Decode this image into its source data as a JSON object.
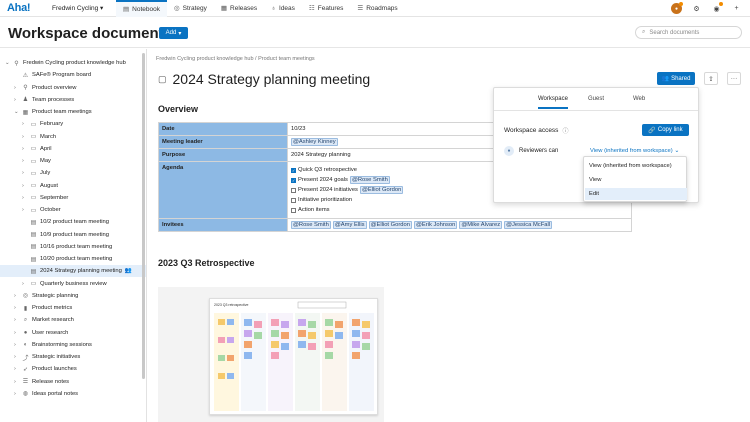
{
  "nav": {
    "logo": "Aha!",
    "workspace": "Fredwin Cycling ▾",
    "tabs": [
      {
        "label": "Notebook",
        "icon": "notebook-icon",
        "active": true
      },
      {
        "label": "Strategy",
        "icon": "strategy-icon"
      },
      {
        "label": "Releases",
        "icon": "calendar-icon"
      },
      {
        "label": "Ideas",
        "icon": "lightbulb-icon"
      },
      {
        "label": "Features",
        "icon": "features-icon"
      },
      {
        "label": "Roadmaps",
        "icon": "roadmap-icon"
      }
    ]
  },
  "header": {
    "title": "Workspace documents",
    "add_label": "Add",
    "search_placeholder": "Search documents"
  },
  "sidebar": {
    "items": [
      {
        "label": "Fredwin Cycling product knowledge hub",
        "depth": 0,
        "chev": "⌄",
        "icon": "hub-icon"
      },
      {
        "label": "SAFe® Program board",
        "depth": 1,
        "chev": "",
        "icon": "board-icon"
      },
      {
        "label": "Product overview",
        "depth": 1,
        "chev": "›",
        "icon": "overview-icon"
      },
      {
        "label": "Team processes",
        "depth": 1,
        "chev": "›",
        "icon": "team-icon"
      },
      {
        "label": "Product team meetings",
        "depth": 1,
        "chev": "⌄",
        "icon": "calendar-icon"
      },
      {
        "label": "February",
        "depth": 2,
        "chev": "›",
        "icon": "folder-icon"
      },
      {
        "label": "March",
        "depth": 2,
        "chev": "›",
        "icon": "folder-icon"
      },
      {
        "label": "April",
        "depth": 2,
        "chev": "›",
        "icon": "folder-icon"
      },
      {
        "label": "May",
        "depth": 2,
        "chev": "›",
        "icon": "folder-icon"
      },
      {
        "label": "July",
        "depth": 2,
        "chev": "›",
        "icon": "folder-icon"
      },
      {
        "label": "August",
        "depth": 2,
        "chev": "›",
        "icon": "folder-icon"
      },
      {
        "label": "September",
        "depth": 2,
        "chev": "›",
        "icon": "folder-icon"
      },
      {
        "label": "October",
        "depth": 2,
        "chev": "›",
        "icon": "folder-icon"
      },
      {
        "label": "10/2 product team meeting",
        "depth": 2,
        "chev": "",
        "icon": "doc-icon"
      },
      {
        "label": "10/9 product team meeting",
        "depth": 2,
        "chev": "",
        "icon": "doc-icon"
      },
      {
        "label": "10/16 product team meeting",
        "depth": 2,
        "chev": "",
        "icon": "doc-icon"
      },
      {
        "label": "10/20 product team meeting",
        "depth": 2,
        "chev": "",
        "icon": "doc-icon"
      },
      {
        "label": "2024 Strategy planning meeting",
        "depth": 2,
        "chev": "",
        "icon": "doc-icon",
        "selected": true
      },
      {
        "label": "Quarterly business review",
        "depth": 2,
        "chev": "›",
        "icon": "folder-icon"
      },
      {
        "label": "Strategic planning",
        "depth": 1,
        "chev": "›",
        "icon": "target-icon"
      },
      {
        "label": "Product metrics",
        "depth": 1,
        "chev": "›",
        "icon": "metrics-icon"
      },
      {
        "label": "Market research",
        "depth": 1,
        "chev": "›",
        "icon": "research-icon"
      },
      {
        "label": "User research",
        "depth": 1,
        "chev": "›",
        "icon": "user-icon"
      },
      {
        "label": "Brainstorming sessions",
        "depth": 1,
        "chev": "›",
        "icon": "bulb-icon"
      },
      {
        "label": "Strategic initiatives",
        "depth": 1,
        "chev": "›",
        "icon": "initiative-icon"
      },
      {
        "label": "Product launches",
        "depth": 1,
        "chev": "›",
        "icon": "rocket-icon"
      },
      {
        "label": "Release notes",
        "depth": 1,
        "chev": "›",
        "icon": "notes-icon"
      },
      {
        "label": "Ideas portal notes",
        "depth": 1,
        "chev": "›",
        "icon": "ideas-icon"
      }
    ]
  },
  "doc": {
    "breadcrumb": "Fredwin Cycling product knowledge hub  /  Product team meetings",
    "title": "2024 Strategy planning meeting",
    "shared_label": "Shared",
    "overview_heading": "Overview",
    "rows": {
      "date_key": "Date",
      "date_val": "10/23",
      "leader_key": "Meeting leader",
      "leader_val": "@Ashley Kinney",
      "purpose_key": "Purpose",
      "purpose_val": "2024 Strategy planning",
      "agenda_key": "Agenda",
      "invitees_key": "Invitees"
    },
    "agenda": [
      {
        "text": "Quick Q3 retrospective",
        "checked": true,
        "mention": ""
      },
      {
        "text": "Present 2024 goals",
        "checked": true,
        "mention": "@Rose Smith"
      },
      {
        "text": "Present 2024 initiatives",
        "checked": false,
        "mention": "@Elliot Gordon"
      },
      {
        "text": "Initiative prioritization",
        "checked": false,
        "mention": ""
      },
      {
        "text": "Action items",
        "checked": false,
        "mention": ""
      }
    ],
    "invitees": [
      "@Rose Smith",
      "@Amy Ellis",
      "@Elliot Gordon",
      "@Erik Johnson",
      "@Mike Alvarez",
      "@Jessica McFall"
    ],
    "retro_heading": "2023 Q3 Retrospective",
    "board_title": "2023 Q3 retrospective"
  },
  "share": {
    "tabs": [
      "Workspace",
      "Guest",
      "Web"
    ],
    "access_label": "Workspace access",
    "copy_link": "Copy link",
    "reviewers_label": "Reviewers can",
    "reviewers_value": "View (inherited from workspace)",
    "options": [
      "View (inherited from workspace)",
      "View",
      "Edit"
    ],
    "highlighted_option": "Edit"
  },
  "colors": {
    "accent": "#0a73c2",
    "table_key_bg": "#8db9e4",
    "selection": "#e3eefa"
  }
}
